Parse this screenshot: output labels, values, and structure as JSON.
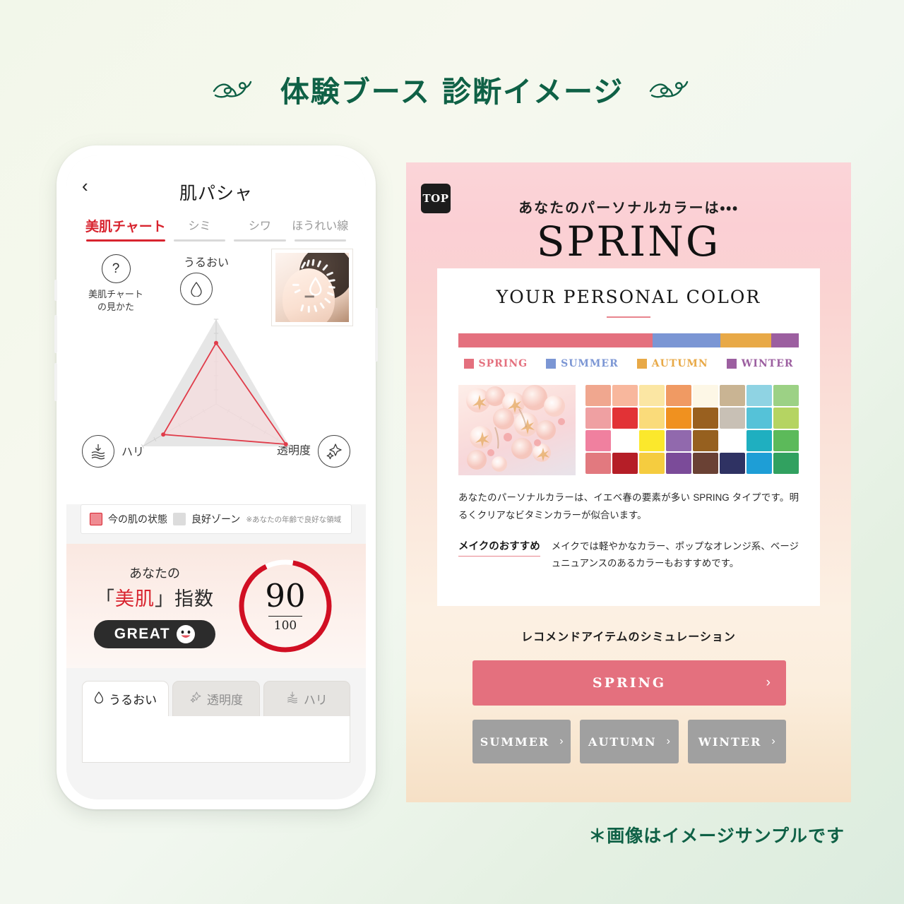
{
  "page": {
    "title": "体験ブース 診断イメージ",
    "footnote": "＊画像はイメージサンプルです",
    "title_color": "#0f6146"
  },
  "phone_app": {
    "back_icon": "‹",
    "logo": "肌パシャ",
    "tabs": [
      {
        "label": "美肌チャート",
        "active": true
      },
      {
        "label": "シミ",
        "active": false
      },
      {
        "label": "シワ",
        "active": false
      },
      {
        "label": "ほうれい線",
        "active": false
      }
    ],
    "help": {
      "icon": "?",
      "line1": "美肌チャート",
      "line2": "の見かた"
    },
    "axes": {
      "top": "うるおい",
      "left": "ハリ",
      "right": "透明度"
    },
    "legend": {
      "current_label": "今の肌の状態",
      "current_color": "#ef8b92",
      "zone_label": "良好ゾーン",
      "zone_color": "#dcdcdc",
      "note": "※あなたの年齢で良好な領域"
    },
    "score": {
      "line1": "あなたの",
      "line2_pre": "「",
      "line2_red": "美肌",
      "line2_post": "」指数",
      "badge": "GREAT",
      "value": "90",
      "max": "100",
      "percent": 90,
      "gauge_color": "#d10f23"
    },
    "bottom_tabs": [
      {
        "label": "うるおい",
        "icon": "droplet-icon",
        "active": true
      },
      {
        "label": "透明度",
        "icon": "sparkle-icon",
        "active": false
      },
      {
        "label": "ハリ",
        "icon": "firmness-icon",
        "active": false
      }
    ]
  },
  "result_panel": {
    "top_badge": "TOP",
    "lead": "あなたのパーソナルカラーは・・・",
    "season": "SPRING",
    "card_title": "YOUR PERSONAL COLOR",
    "season_legend": [
      {
        "name": "SPRING",
        "color": "#e4707e",
        "share": 57
      },
      {
        "name": "SUMMER",
        "color": "#7b96d4",
        "share": 20
      },
      {
        "name": "AUTUMN",
        "color": "#e8a947",
        "share": 15
      },
      {
        "name": "WINTER",
        "color": "#9c5fa0",
        "share": 8
      }
    ],
    "swatches": [
      "#f0a78f",
      "#f8b79d",
      "#fbe6a3",
      "#f09a63",
      "#fdf7e6",
      "#c9b493",
      "#8fd3e3",
      "#9cd185",
      "#efa0a2",
      "#e23236",
      "#fadb7a",
      "#f0911f",
      "#99601f",
      "#c8c0b5",
      "#55c2d8",
      "#b5d462",
      "#f0809f",
      "#ffffff",
      "#fbe82c",
      "#9169ad",
      "#96601f",
      "#ffffff",
      "#1fafc0",
      "#5cba5a",
      "#e2797f",
      "#b51e27",
      "#f5cc3f",
      "#7b4b99",
      "#6a4134",
      "#2f3263",
      "#1e9ed6",
      "#31a160"
    ],
    "description": "あなたのパーソナルカラーは、イエベ春の要素が多い SPRING タイプです。明るくクリアなビタミンカラーが似合います。",
    "makeup_heading": "メイクのおすすめ",
    "makeup_body": "メイクでは軽やかなカラー、ポップなオレンジ系、ベージュニュアンスのあるカラーもおすすめです。",
    "sim_title": "レコメンドアイテムのシミュレーション",
    "primary_button": {
      "label": "SPRING",
      "chevron": "›",
      "color": "#e4707e"
    },
    "secondary_buttons": [
      {
        "label": "SUMMER",
        "chevron": "›"
      },
      {
        "label": "AUTUMN",
        "chevron": "›"
      },
      {
        "label": "WINTER",
        "chevron": "›"
      }
    ]
  },
  "chart_data": {
    "type": "radar",
    "title": "美肌チャート",
    "categories": [
      "うるおい",
      "透明度",
      "ハリ"
    ],
    "series": [
      {
        "name": "今の肌の状態",
        "values": [
          72,
          95,
          72
        ],
        "color": "#e03c4a"
      },
      {
        "name": "良好ゾーン",
        "values": [
          100,
          100,
          100
        ],
        "color": "#e6e6e6"
      }
    ],
    "rmax": 100,
    "ticks": 6,
    "legend": "bottom"
  }
}
